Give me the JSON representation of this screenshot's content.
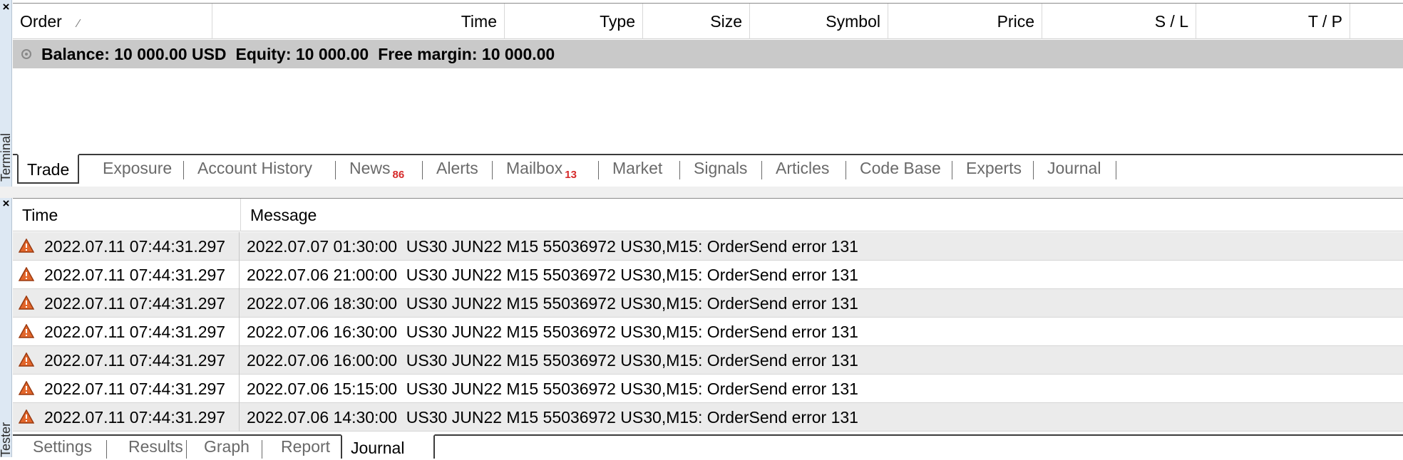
{
  "terminal": {
    "side_label": "Terminal",
    "columns": [
      "Order",
      "Time",
      "Type",
      "Size",
      "Symbol",
      "Price",
      "S / L",
      "T / P"
    ],
    "balance_line": {
      "balance": "Balance: 10 000.00 USD",
      "equity": "Equity: 10 000.00",
      "free_margin": "Free margin: 10 000.00"
    },
    "tabs": [
      {
        "label": "Trade",
        "active": true
      },
      {
        "label": "Exposure"
      },
      {
        "label": "Account History"
      },
      {
        "label": "News",
        "badge": "86"
      },
      {
        "label": "Alerts"
      },
      {
        "label": "Mailbox",
        "badge": "13"
      },
      {
        "label": "Market"
      },
      {
        "label": "Signals"
      },
      {
        "label": "Articles"
      },
      {
        "label": "Code Base"
      },
      {
        "label": "Experts"
      },
      {
        "label": "Journal"
      }
    ]
  },
  "tester": {
    "side_label": "Tester",
    "columns": [
      "Time",
      "Message"
    ],
    "rows": [
      {
        "time": "2022.07.11 07:44:31.297",
        "message": "2022.07.07 01:30:00  US30 JUN22 M15 55036972 US30,M15: OrderSend error 131"
      },
      {
        "time": "2022.07.11 07:44:31.297",
        "message": "2022.07.06 21:00:00  US30 JUN22 M15 55036972 US30,M15: OrderSend error 131"
      },
      {
        "time": "2022.07.11 07:44:31.297",
        "message": "2022.07.06 18:30:00  US30 JUN22 M15 55036972 US30,M15: OrderSend error 131"
      },
      {
        "time": "2022.07.11 07:44:31.297",
        "message": "2022.07.06 16:30:00  US30 JUN22 M15 55036972 US30,M15: OrderSend error 131"
      },
      {
        "time": "2022.07.11 07:44:31.297",
        "message": "2022.07.06 16:00:00  US30 JUN22 M15 55036972 US30,M15: OrderSend error 131"
      },
      {
        "time": "2022.07.11 07:44:31.297",
        "message": "2022.07.06 15:15:00  US30 JUN22 M15 55036972 US30,M15: OrderSend error 131"
      },
      {
        "time": "2022.07.11 07:44:31.297",
        "message": "2022.07.06 14:30:00  US30 JUN22 M15 55036972 US30,M15: OrderSend error 131"
      }
    ],
    "tabs": [
      {
        "label": "Settings"
      },
      {
        "label": "Results"
      },
      {
        "label": "Graph"
      },
      {
        "label": "Report"
      },
      {
        "label": "Journal",
        "active": true
      }
    ]
  },
  "icons": {
    "row_icon": "warning-icon",
    "close": "close-icon"
  },
  "colors": {
    "warning_fill": "#e2662b",
    "badge": "#d62b2b",
    "balance_row_bg": "#c9c9c9",
    "alt_row_bg": "#ebebeb"
  }
}
